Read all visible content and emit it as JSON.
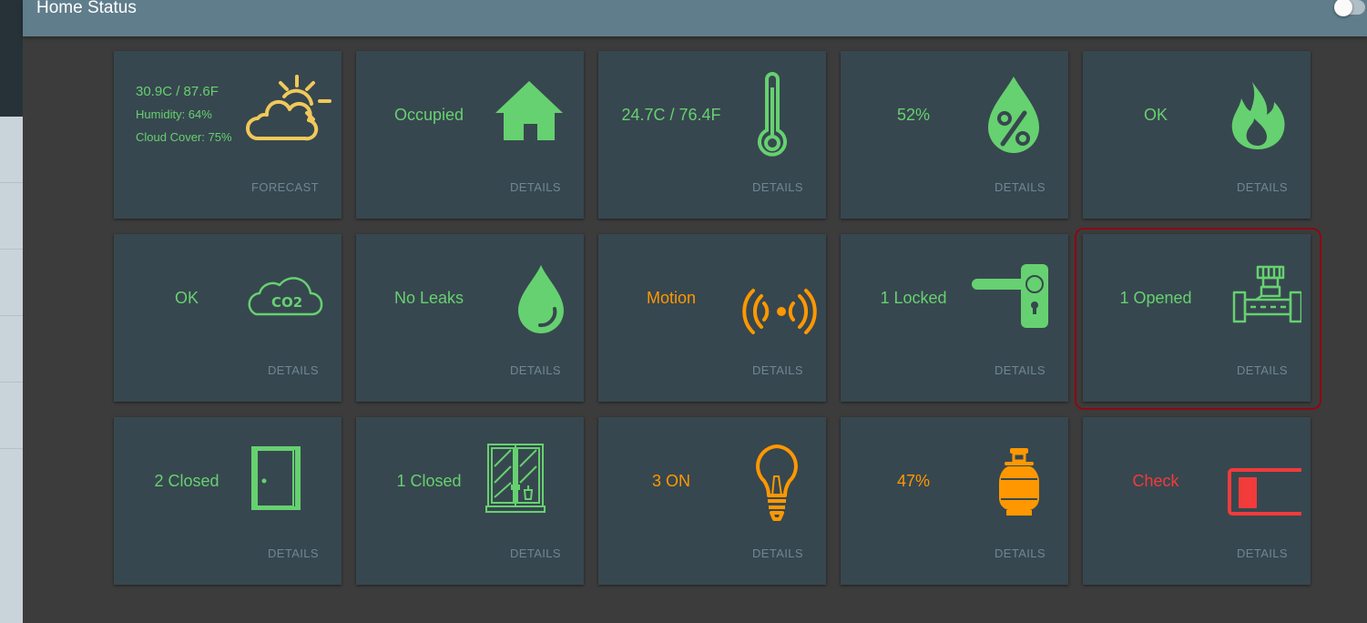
{
  "header": {
    "title": "Home Status"
  },
  "colors": {
    "green": "#66d170",
    "orange": "#ff9800",
    "red": "#f23b3b",
    "tile": "#37474f",
    "header": "#607d8b"
  },
  "tiles": [
    {
      "id": "forecast",
      "temp": "30.9C / 87.6F",
      "humidity": "Humidity: 64%",
      "cloud": "Cloud Cover: 75%",
      "action": "FORECAST",
      "icon": "partly-cloudy-icon"
    },
    {
      "id": "presence",
      "value": "Occupied",
      "action": "DETAILS",
      "icon": "home-icon"
    },
    {
      "id": "temperature",
      "value": "24.7C / 76.4F",
      "action": "DETAILS",
      "icon": "thermometer-icon"
    },
    {
      "id": "humidity",
      "value": "52%",
      "action": "DETAILS",
      "icon": "humidity-drop-icon"
    },
    {
      "id": "smoke",
      "value": "OK",
      "action": "DETAILS",
      "icon": "flame-icon"
    },
    {
      "id": "co2",
      "value": "OK",
      "action": "DETAILS",
      "icon": "co2-cloud-icon"
    },
    {
      "id": "leak",
      "value": "No Leaks",
      "action": "DETAILS",
      "icon": "water-drop-icon"
    },
    {
      "id": "motion",
      "value": "Motion",
      "action": "DETAILS",
      "icon": "motion-sensor-icon"
    },
    {
      "id": "locks",
      "value": "1 Locked",
      "action": "DETAILS",
      "icon": "door-handle-icon"
    },
    {
      "id": "valves",
      "value": "1 Opened",
      "action": "DETAILS",
      "icon": "valve-icon"
    },
    {
      "id": "doors",
      "value": "2 Closed",
      "action": "DETAILS",
      "icon": "door-icon"
    },
    {
      "id": "windows",
      "value": "1 Closed",
      "action": "DETAILS",
      "icon": "window-icon"
    },
    {
      "id": "lights",
      "value": "3 ON",
      "action": "DETAILS",
      "icon": "light-bulb-icon"
    },
    {
      "id": "gas",
      "value": "47%",
      "action": "DETAILS",
      "icon": "gas-tank-icon"
    },
    {
      "id": "battery",
      "value": "Check",
      "action": "DETAILS",
      "icon": "low-battery-icon"
    }
  ]
}
